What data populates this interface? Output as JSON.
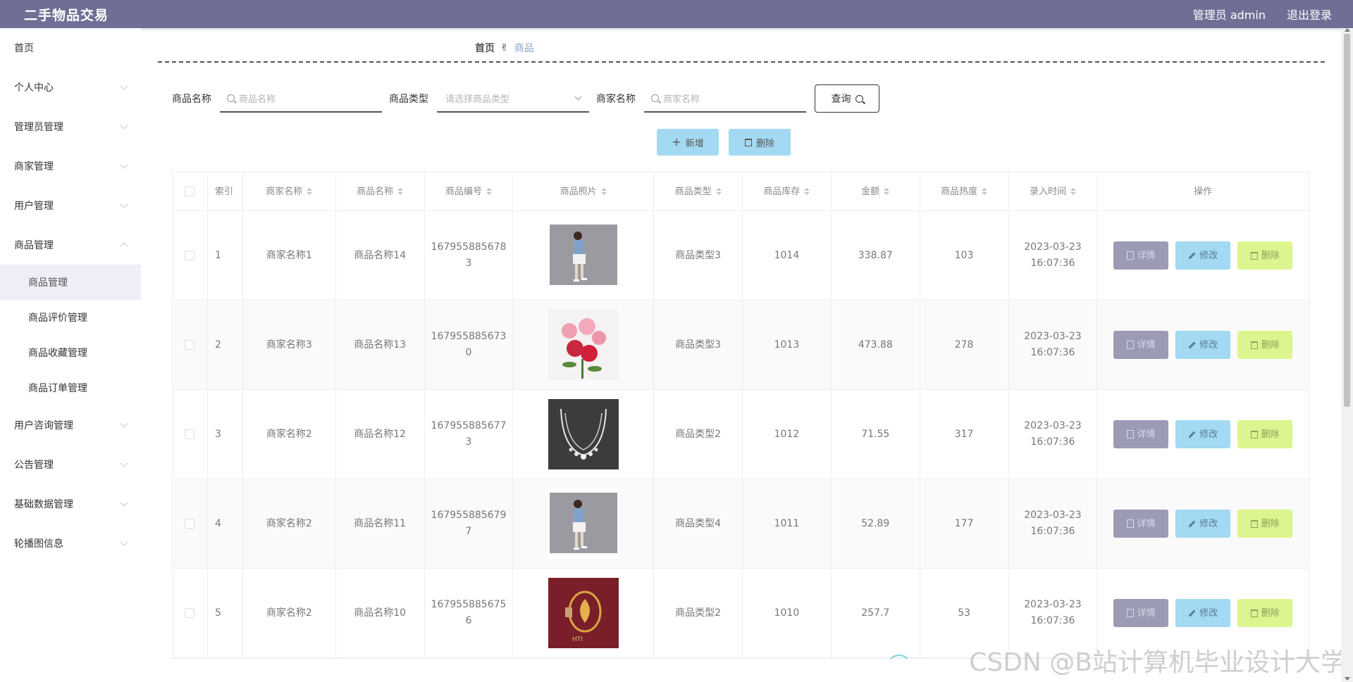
{
  "app_title": "二手物品交易",
  "header": {
    "user": "管理员 admin",
    "logout": "退出登录"
  },
  "sidebar": {
    "items": [
      {
        "label": "首页",
        "chevron": false
      },
      {
        "label": "个人中心",
        "chevron": true
      },
      {
        "label": "管理员管理",
        "chevron": true
      },
      {
        "label": "商家管理",
        "chevron": true
      },
      {
        "label": "用户管理",
        "chevron": true
      },
      {
        "label": "商品管理",
        "chevron": true,
        "expanded": true
      }
    ],
    "sub_items": [
      "商品管理",
      "商品评价管理",
      "商品收藏管理",
      "商品订单管理"
    ],
    "items_after": [
      "用户咨询管理",
      "公告管理",
      "基础数据管理",
      "轮播图信息"
    ]
  },
  "breadcrumb": {
    "home": "首页",
    "current": "商品"
  },
  "search": {
    "name_label": "商品名称",
    "name_placeholder": "商品名称",
    "type_label": "商品类型",
    "type_placeholder": "请选择商品类型",
    "merchant_label": "商家名称",
    "merchant_placeholder": "商家名称",
    "query_button": "查询"
  },
  "actions": {
    "add": "新增",
    "delete": "删除"
  },
  "table": {
    "headers": [
      "索引",
      "商家名称",
      "商品名称",
      "商品编号",
      "商品照片",
      "商品类型",
      "商品库存",
      "金额",
      "商品热度",
      "录入时间",
      "操作"
    ],
    "op_labels": {
      "detail": "详情",
      "edit": "修改",
      "delete": "删除"
    },
    "rows": [
      {
        "idx": "1",
        "merchant": "商家名称1",
        "name": "商品名称14",
        "code": "1679558856783",
        "type": "商品类型3",
        "stock": "1014",
        "price": "338.87",
        "heat": "103",
        "time": "2023-03-23 16:07:36",
        "photo": "girl"
      },
      {
        "idx": "2",
        "merchant": "商家名称3",
        "name": "商品名称13",
        "code": "1679558856730",
        "type": "商品类型3",
        "stock": "1013",
        "price": "473.88",
        "heat": "278",
        "time": "2023-03-23 16:07:36",
        "photo": "roses"
      },
      {
        "idx": "3",
        "merchant": "商家名称2",
        "name": "商品名称12",
        "code": "1679558856773",
        "type": "商品类型2",
        "stock": "1012",
        "price": "71.55",
        "heat": "317",
        "time": "2023-03-23 16:07:36",
        "photo": "necklace"
      },
      {
        "idx": "4",
        "merchant": "商家名称2",
        "name": "商品名称11",
        "code": "1679558856797",
        "type": "商品类型4",
        "stock": "1011",
        "price": "52.89",
        "heat": "177",
        "time": "2023-03-23 16:07:36",
        "photo": "girl"
      },
      {
        "idx": "5",
        "merchant": "商家名称2",
        "name": "商品名称10",
        "code": "1679558856756",
        "type": "商品类型2",
        "stock": "1010",
        "price": "257.7",
        "heat": "53",
        "time": "2023-03-23 16:07:36",
        "photo": "pendant"
      }
    ]
  },
  "watermark": "CSDN @B站计算机毕业设计大学",
  "colors": {
    "topbar": "#6f6f96",
    "detail_btn": "#9b9bb6",
    "edit_btn": "#a3d9f2",
    "delete_btn": "#dcf58f"
  }
}
